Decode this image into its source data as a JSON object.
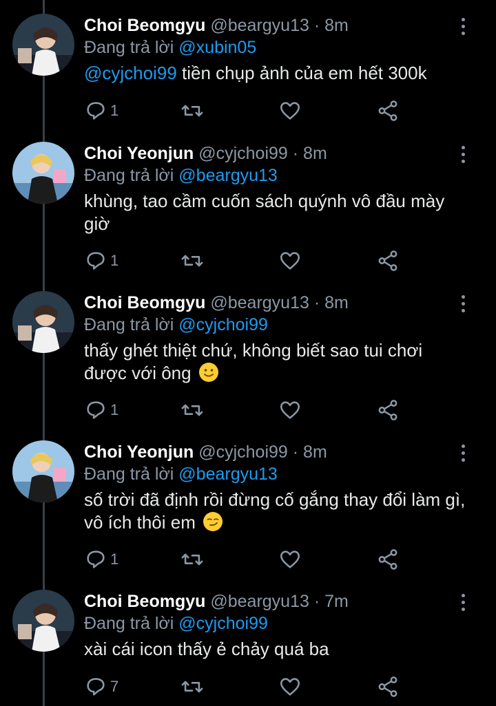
{
  "tweets": [
    {
      "name": "Choi Beomgyu",
      "handle": "@beargyu13",
      "time": "8m",
      "reply_prefix": "Đang trả lời ",
      "reply_to": "@xubin05",
      "mention": "@cyjchoi99",
      "text": " tiền chụp ảnh của em hết 300k",
      "emoji": "",
      "reply_count": "1",
      "avatar": "beomgyu"
    },
    {
      "name": "Choi Yeonjun",
      "handle": "@cyjchoi99",
      "time": "8m",
      "reply_prefix": "Đang trả lời ",
      "reply_to": "@beargyu13",
      "mention": "",
      "text": "khùng, tao cầm cuốn sách quýnh vô đầu mày giờ",
      "emoji": "",
      "reply_count": "1",
      "avatar": "yeonjun"
    },
    {
      "name": "Choi Beomgyu",
      "handle": "@beargyu13",
      "time": "8m",
      "reply_prefix": "Đang trả lời ",
      "reply_to": "@cyjchoi99",
      "mention": "",
      "text": "thấy ghét thiệt chứ, không biết sao tui chơi được với ông",
      "emoji": "slightly-smiling-face",
      "reply_count": "1",
      "avatar": "beomgyu"
    },
    {
      "name": "Choi Yeonjun",
      "handle": "@cyjchoi99",
      "time": "8m",
      "reply_prefix": "Đang trả lời ",
      "reply_to": "@beargyu13",
      "mention": "",
      "text": "số trời đã định rồi đừng cố gắng thay đổi làm gì, vô ích thôi em",
      "emoji": "smirking-face",
      "reply_count": "1",
      "avatar": "yeonjun"
    },
    {
      "name": "Choi Beomgyu",
      "handle": "@beargyu13",
      "time": "7m",
      "reply_prefix": "Đang trả lời ",
      "reply_to": "@cyjchoi99",
      "mention": "",
      "text": "xài cái icon thấy ẻ chảy quá ba",
      "emoji": "",
      "reply_count": "7",
      "avatar": "beomgyu"
    }
  ],
  "separator": " · ",
  "icons": [
    "reply-icon",
    "retweet-icon",
    "like-icon",
    "share-icon",
    "more-icon"
  ],
  "colors": {
    "background": "#000000",
    "name": "#ffffff",
    "secondary": "#8b98a5",
    "mention": "#1d9bf0",
    "thread_line": "#3a3f44"
  }
}
